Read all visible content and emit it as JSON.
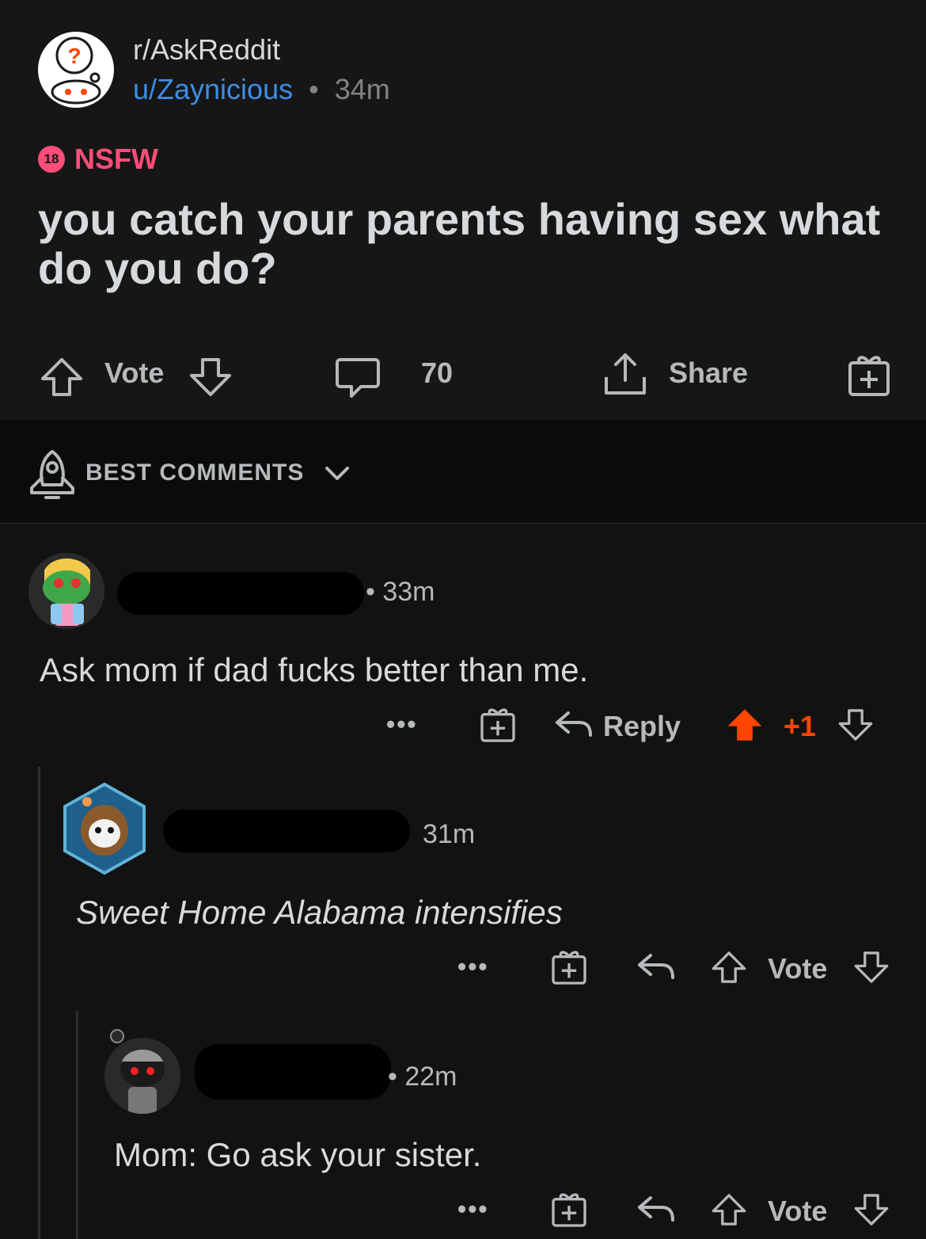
{
  "post": {
    "subreddit": "r/AskReddit",
    "author": "u/Zaynicious",
    "separator": "•",
    "age": "34m",
    "nsfw_badge": "18",
    "nsfw_label": "NSFW",
    "title": "you catch your parents having sex what do you do?",
    "vote_label": "Vote",
    "comment_count": "70",
    "share_label": "Share"
  },
  "sort": {
    "label": "BEST COMMENTS"
  },
  "comments": [
    {
      "age": "• 33m",
      "body": "Ask mom if dad fucks better than me.",
      "reply_label": "Reply",
      "score": "+1",
      "more": "•••"
    },
    {
      "age": "31m",
      "body": "Sweet Home Alabama intensifies",
      "vote_label": "Vote",
      "more": "•••"
    },
    {
      "age": "• 22m",
      "body": "Mom: Go ask your sister.",
      "vote_label": "Vote",
      "more": "•••"
    }
  ],
  "colors": {
    "background": "#121212",
    "nsfw": "#ff4d79",
    "upvote_active": "#ff4500",
    "author_link": "#3d8ee6"
  }
}
